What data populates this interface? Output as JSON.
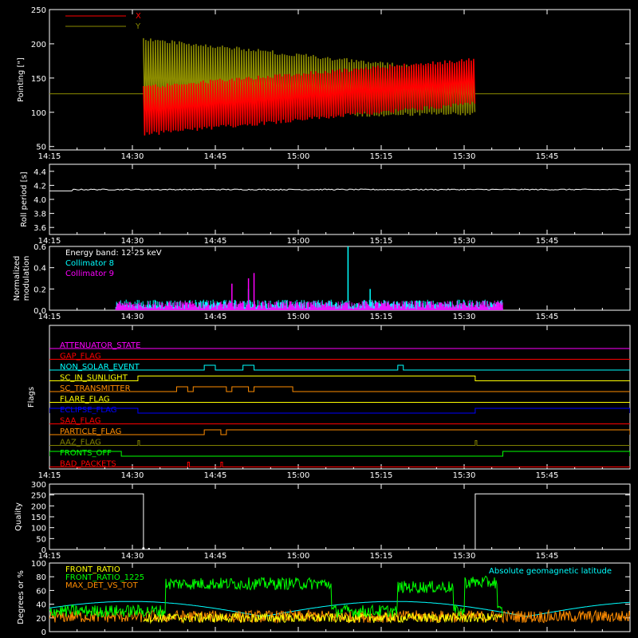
{
  "time_ticks": [
    "14:15",
    "14:30",
    "14:45",
    "15:00",
    "15:15",
    "15:30",
    "15:45"
  ],
  "colors": {
    "x": "#ff0000",
    "y": "#8b8b00",
    "white": "#ffffff",
    "cyan": "#00ffff",
    "magenta": "#ff00ff",
    "green": "#00ff00",
    "orange": "#ff8c00",
    "yellow": "#ffff00",
    "blue": "#0000ff",
    "olive": "#808000",
    "red": "#ff0000"
  },
  "chart_data": [
    {
      "type": "line",
      "id": "pointing",
      "ylabel": "Pointing [\"]",
      "ylim": [
        45,
        250
      ],
      "yticks": [
        50,
        100,
        150,
        200,
        250
      ],
      "legend": [
        "X",
        "Y"
      ],
      "series": [
        {
          "name": "X",
          "color": "#ff0000",
          "points": [
            [
              "14:15",
              127
            ],
            [
              "14:32",
              127
            ],
            [
              "14:32",
              100
            ],
            [
              "14:45",
              115
            ],
            [
              "15:00",
              148
            ],
            [
              "15:15",
              165
            ],
            [
              "15:32",
              160
            ],
            [
              "15:32",
              127
            ],
            [
              "16:00",
              127
            ]
          ]
        },
        {
          "name": "Y",
          "color": "#8b8b00",
          "points": [
            [
              "14:15",
              127
            ],
            [
              "14:32",
              127
            ],
            [
              "14:32",
              160
            ],
            [
              "14:45",
              140
            ],
            [
              "15:00",
              110
            ],
            [
              "15:15",
              95
            ],
            [
              "15:32",
              100
            ],
            [
              "15:32",
              127
            ],
            [
              "16:00",
              127
            ]
          ]
        }
      ]
    },
    {
      "type": "line",
      "id": "roll",
      "ylabel": "Roll period [s]",
      "ylim": [
        3.5,
        4.5
      ],
      "yticks": [
        3.6,
        3.8,
        4.0,
        4.2,
        4.4
      ],
      "series": [
        {
          "name": "",
          "color": "#ffffff",
          "points": [
            [
              "14:15",
              4.12
            ],
            [
              "14:17",
              4.15
            ],
            [
              "16:00",
              4.14
            ]
          ]
        }
      ]
    },
    {
      "type": "bar",
      "id": "modulation",
      "ylabel": "Normalized modulation",
      "ylim": [
        0,
        0.6
      ],
      "yticks": [
        0.0,
        0.2,
        0.4,
        0.6
      ],
      "annotation": "Energy band: 12-25 keV",
      "legend": [
        "Collimator 8",
        "Collimator 9"
      ],
      "series": [
        {
          "name": "Collimator 8",
          "color": "#00ffff",
          "start": "14:27",
          "end": "15:37",
          "typical": 0.06,
          "spikes": [
            [
              "15:09",
              0.6
            ],
            [
              "14:51",
              0.2
            ],
            [
              "15:13",
              0.2
            ]
          ]
        },
        {
          "name": "Collimator 9",
          "color": "#ff00ff",
          "start": "14:27",
          "end": "15:37",
          "typical": 0.05,
          "spikes": [
            [
              "14:52",
              0.35
            ],
            [
              "14:51",
              0.3
            ],
            [
              "14:48",
              0.25
            ]
          ]
        }
      ]
    },
    {
      "type": "step",
      "id": "flags",
      "ylabel": "Flags",
      "rows": [
        {
          "name": "ATTENUATOR_STATE",
          "color": "#ff00ff",
          "high": []
        },
        {
          "name": "GAP_FLAG",
          "color": "#ff0000",
          "high": []
        },
        {
          "name": "NON_SOLAR_EVENT",
          "color": "#00ffff",
          "high": [
            [
              "14:43",
              "14:45"
            ],
            [
              "14:50",
              "14:52"
            ],
            [
              "15:18",
              "15:19"
            ]
          ]
        },
        {
          "name": "SC_IN_SUNLIGHT",
          "color": "#ffff00",
          "high": [
            [
              "14:31",
              "15:32"
            ]
          ]
        },
        {
          "name": "SC_TRANSMITTER",
          "color": "#ff8c00",
          "high": [
            [
              "14:38",
              "14:40"
            ],
            [
              "14:41",
              "14:47"
            ],
            [
              "14:48",
              "14:51"
            ],
            [
              "14:52",
              "14:59"
            ]
          ]
        },
        {
          "name": "FLARE_FLAG",
          "color": "#ffff00",
          "high": []
        },
        {
          "name": "ECLIPSE_FLAG",
          "color": "#0000ff",
          "high": [
            [
              "14:15",
              "14:31"
            ],
            [
              "15:32",
              "16:00"
            ]
          ]
        },
        {
          "name": "SAA_FLAG",
          "color": "#ff0000",
          "high": []
        },
        {
          "name": "PARTICLE_FLAG",
          "color": "#ff8c00",
          "high": [
            [
              "14:43",
              "14:46"
            ],
            [
              "14:47",
              "16:00"
            ]
          ]
        },
        {
          "name": "AAZ_FLAG",
          "color": "#808000",
          "high": [
            [
              "14:31",
              "14:31.3"
            ],
            [
              "15:32",
              "15:32.3"
            ]
          ]
        },
        {
          "name": "FRONTS_OFF",
          "color": "#00ff00",
          "high": [
            [
              "14:15",
              "14:28"
            ],
            [
              "15:37",
              "16:00"
            ]
          ]
        },
        {
          "name": "BAD_PACKETS",
          "color": "#ff0000",
          "high": [
            [
              "14:40",
              "14:40.3"
            ],
            [
              "14:46",
              "14:46.3"
            ]
          ]
        }
      ]
    },
    {
      "type": "line",
      "id": "quality",
      "ylabel": "Quality",
      "ylim": [
        0,
        300
      ],
      "yticks": [
        0,
        50,
        100,
        150,
        200,
        250,
        300
      ],
      "series": [
        {
          "name": "",
          "color": "#ffffff",
          "points": [
            [
              "14:15",
              255
            ],
            [
              "14:32",
              255
            ],
            [
              "14:32",
              0
            ],
            [
              "15:32",
              0
            ],
            [
              "15:32",
              255
            ],
            [
              "16:00",
              255
            ]
          ]
        }
      ]
    },
    {
      "type": "line",
      "id": "geo",
      "ylabel": "Degrees or %",
      "ylim": [
        0,
        100
      ],
      "yticks": [
        0,
        20,
        40,
        60,
        80,
        100
      ],
      "legend": [
        "FRONT_RATIO",
        "FRONT_RATIO_1225",
        "MAX_DET_VS_TOT",
        "Absolute geomagnetic latitude"
      ],
      "series": [
        {
          "name": "FRONT_RATIO",
          "color": "#ffff00",
          "level": 20
        },
        {
          "name": "FRONT_RATIO_1225",
          "color": "#00ff00",
          "level": 55
        },
        {
          "name": "MAX_DET_VS_TOT",
          "color": "#ff8c00",
          "level": 25
        },
        {
          "name": "Absolute geomagnetic latitude",
          "color": "#00ffff",
          "level": 30
        }
      ]
    }
  ]
}
